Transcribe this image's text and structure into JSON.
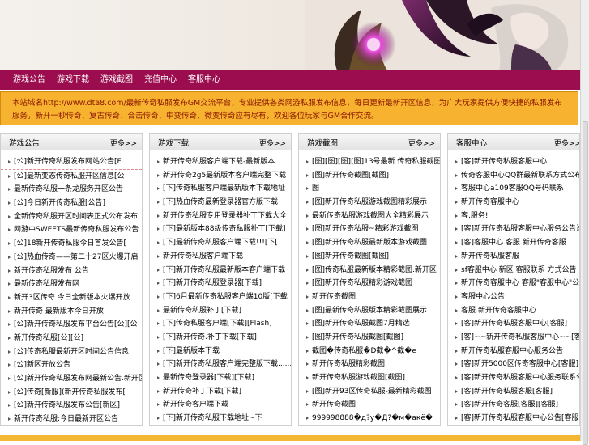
{
  "nav": [
    "游戏公告",
    "游戏下载",
    "游戏截图",
    "充值中心",
    "客服中心"
  ],
  "notice": "本站域名http://www.dta8.com/最新传奇私服发布GM交流平台，专业提供各类网游私服发布信息，每日更新最新开区信息，为广大玩家提供方便快捷的私服发布服务，新开一秒传奇、复古传奇、合击传奇、中变传奇、微变传奇应有尽有，欢迎各位玩家与GM合作交流。",
  "panels": [
    {
      "title": "游戏公告",
      "more": "更多>>",
      "items": [
        "[公]新开传奇私服发布网站公告[F",
        "[公]最新变态传奇私服开区信息[公",
        "最新传奇私服一条龙服务开区公告",
        "[公]今日新开传奇私服[公告]",
        "全新传奇私服开区时间表正式公布发布",
        "网游中SWEETS最新传奇私服发布公告",
        "[公]18新开传奇私服今日首发公告[",
        "[公]热血传奇——第二十27区火爆开启",
        "新开传奇私服发布 公告",
        "最新传奇私服发布网",
        "新开3区传奇 今日全新版本火爆开放",
        "新开传奇 最新版本今日开放",
        "[公]新开传奇私服发布平台公告[公][公",
        "新开传奇私服[公][公]",
        "[公]传奇私服最新开区时间公告信息",
        "[公]新区开放公告",
        "[公]新开传奇私服发布网最新公告.新开区",
        "[公]传奇[新服](新开传奇私服发布[",
        "[公]新开传奇私服发布公告[新区]",
        "新开传奇私服:今日最新开区公告"
      ]
    },
    {
      "title": "游戏下载",
      "more": "更多>>",
      "items": [
        "新开传奇私服客户端下载-最新版本",
        "新开传奇2g5最新版本客户端完整下载",
        "[下]传奇私服客户端最新版本下载地址",
        "[下]热血传奇最新登录器官方版下载",
        "新开传奇私服专用登录器补丁下载大全",
        "[下]最新版本88级传奇私服补丁[下载]",
        "[下]最新传奇私服客户端下载!!![下[",
        "新开传奇私服客户端下载",
        "[下]新开传奇私服最新版本客户端下载",
        "[下]新开传奇私服登录器[下载]",
        "[下]6月最新传奇私服客户端10版[下载",
        "最新传奇私服补丁[下载]",
        "[下]传奇私服客户端[下载][Flash]",
        "[下]新开传奇.补丁下载[下载]",
        "[下]最新版本下载",
        "[下]新开传奇私服客户端完整版下载......",
        "最新传奇登录器[下载][下载]",
        "新开传奇补丁下载[下载]",
        "新开传奇客户端下载",
        "[下]新开传奇私服下载地址~下"
      ]
    },
    {
      "title": "游戏截图",
      "more": "更多>>",
      "items": [
        "[图][图][图][图]13号最新.传奇私服截图",
        "[图]新开传奇截图[截图]",
        "图",
        "[图]新开传奇私服游戏截图精彩展示",
        "最新传奇私服游戏截图大全精彩展示",
        "[图]新开传奇私服~精彩游戏截图",
        "[图]新开传奇私服最新版本游戏截图",
        "[图]新开传奇截图[截图]",
        "[图]传奇私服最新版本精彩截图.新开区",
        "[图]新开传奇私服精彩游戏截图",
        "新开传奇截图",
        "[图]最新传奇私服版本精彩截图展示",
        "[图]新开传奇私服截图7月精选",
        "[图]新开传奇私服截图[截图]",
        "截图�传奇私服�D截�^截�e",
        "新开传奇私服精彩截图",
        "新开传奇私服游戏截图[截图]",
        "[图]新开93区传奇私服-最新精彩截图",
        "新开传奇截图",
        "999998888�д?у�Д?�м�акё�"
      ]
    },
    {
      "title": "客服中心",
      "more": "更多>>",
      "items": [
        "[客]新开传奇私服客服中心",
        "传奇客服中心QQ群最新联系方式公布",
        "客服中心a109客服QQ号码联系",
        "新开传奇客服中心",
        "客.服务!",
        "[客]新开传奇私服客服中心服务公告说明",
        "[客]客服中心.客服.新开传奇客服",
        "新开传奇私服客服",
        "sf客服中心 新区 客服联系 方式公告",
        "新开传奇客服中心 客服\"客服中心\"公告",
        "客服中心公告",
        "客服.新开传奇客服中心",
        "[客]新开传奇私服客服中心[客服]",
        "[客]~~新开传奇私服客服中心~~[客服][客",
        "新开传奇私服客服中心服务公告",
        "[客]新开5000区传奇客服中心[客服]",
        "[客]新开传奇私服客服中心服务联系公告",
        "[客]新开传奇私服客服[客服]",
        "[客]新开传奇客服[客服][客服]",
        "[客]新开传奇私服客服中心公告[客服]"
      ]
    }
  ]
}
